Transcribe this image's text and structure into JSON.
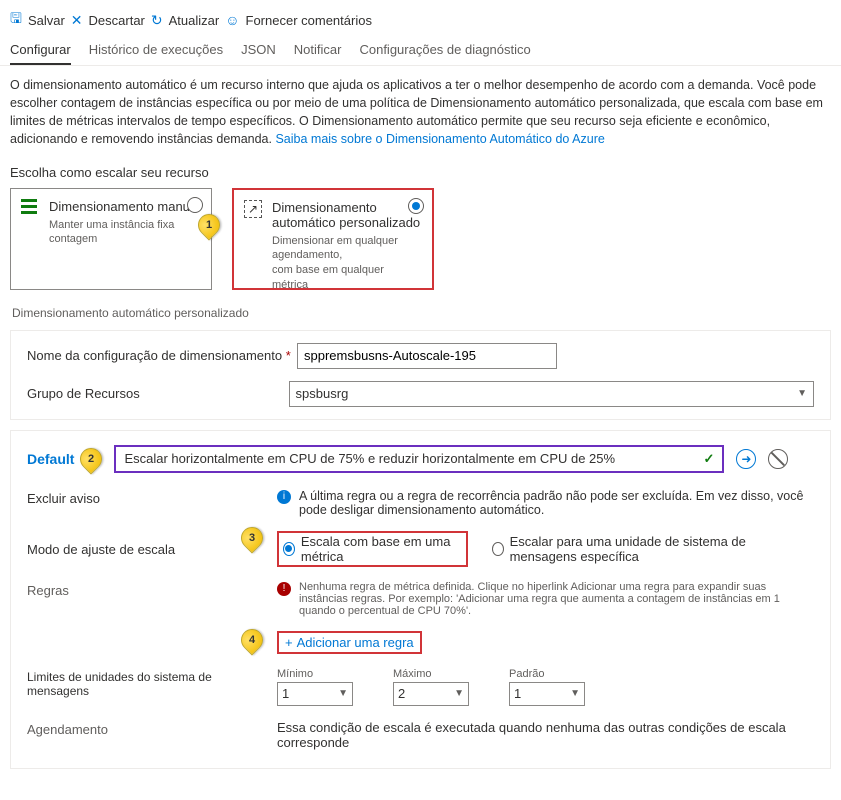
{
  "toolbar": {
    "save": "Salvar",
    "discard": "Descartar",
    "refresh": "Atualizar",
    "feedback": "Fornecer comentários"
  },
  "tabs": {
    "configure": "Configurar",
    "history": "Histórico de execuções",
    "json": "JSON",
    "notify": "Notificar",
    "diag": "Configurações de diagnóstico"
  },
  "intro": {
    "text": "O dimensionamento automático é um recurso interno que ajuda os aplicativos a ter o melhor desempenho de acordo com a demanda. Você pode escolher contagem de instâncias específica ou por meio de uma política de Dimensionamento automático personalizada, que escala com base em limites de métricas intervalos de tempo específicos. O Dimensionamento automático permite que seu recurso seja eficiente e econômico, adicionando e removendo instâncias demanda. ",
    "link": "Saiba mais sobre o Dimensionamento Automático do Azure"
  },
  "chooseLabel": "Escolha como escalar seu recurso",
  "cards": {
    "manual": {
      "title": "Dimensionamento manual",
      "desc": "Manter uma instância fixa contagem"
    },
    "auto": {
      "title": "Dimensionamento automático personalizado",
      "desc1": "Dimensionar em qualquer agendamento,",
      "desc2": "com base em qualquer métrica"
    }
  },
  "subheading": "Dimensionamento automático personalizado",
  "form": {
    "nameLabel": "Nome da configuração de dimensionamento",
    "nameValue": "sppremsbusns-Autoscale-195",
    "rgLabel": "Grupo de Recursos",
    "rgValue": "spsbusrg"
  },
  "default": {
    "label": "Default",
    "scaleName": "Escalar horizontalmente em CPU de 75% e reduzir horizontalmente em CPU de 25%",
    "deleteLabel": "Excluir aviso",
    "deleteMsg": "A última regra ou a regra de recorrência padrão não pode ser excluída. Em vez disso, você pode desligar dimensionamento automático.",
    "modeLabel": "Modo de ajuste de escala",
    "modeMetric": "Escala com base em uma métrica",
    "modeSpecific": "Escalar para uma unidade de sistema de mensagens específica",
    "rulesLabel": "Regras",
    "rulesMsg": "Nenhuma regra de métrica definida. Clique no hiperlink Adicionar uma regra para expandir suas instâncias regras. Por exemplo: 'Adicionar uma regra que aumenta a contagem de instâncias em 1 quando o percentual de CPU 70%'.",
    "addRule": "Adicionar uma regra",
    "limitsLabel": "Limites de unidades do sistema de mensagens",
    "min": "Mínimo",
    "minVal": "1",
    "max": "Máximo",
    "maxVal": "2",
    "def": "Padrão",
    "defVal": "1",
    "schedLabel": "Agendamento",
    "schedText": "Essa condição de escala é executada quando nenhuma das outras condições de escala corresponde"
  },
  "callouts": {
    "c1": "1",
    "c2": "2",
    "c3": "3",
    "c4": "4"
  }
}
